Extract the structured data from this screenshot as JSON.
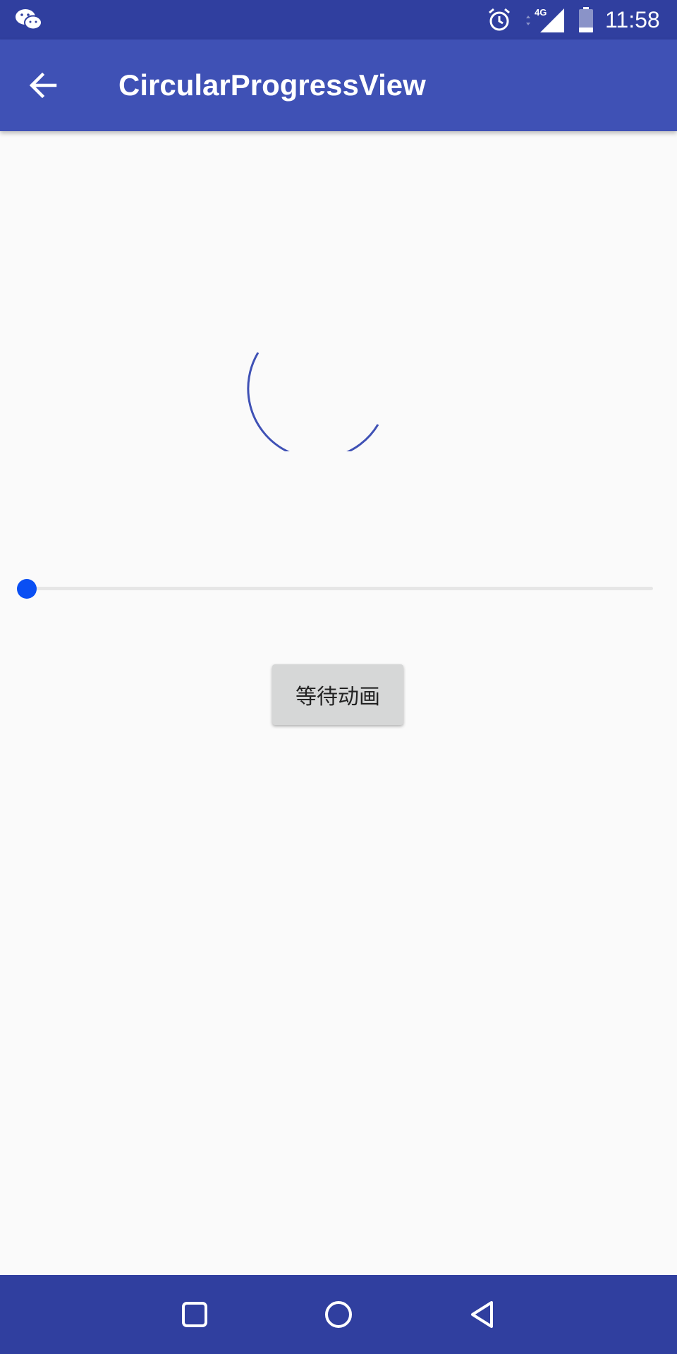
{
  "status_bar": {
    "time": "11:58",
    "network_label": "4G",
    "icons": [
      "wechat-icon",
      "alarm-icon",
      "signal-icon",
      "battery-icon"
    ]
  },
  "app_bar": {
    "title": "CircularProgressView",
    "back_icon": "back-arrow-icon"
  },
  "main": {
    "progress_view": {
      "state": "indeterminate",
      "color": "#3f51b5"
    },
    "seekbar": {
      "value": 0,
      "thumb_color": "#0a4ff3"
    },
    "wait_button_label": "等待动画"
  },
  "nav_bar": {
    "buttons": [
      "recents-icon",
      "home-icon",
      "back-triangle-icon"
    ]
  },
  "colors": {
    "primary_dark": "#303f9f",
    "primary": "#3f51b5",
    "accent": "#0a4ff3",
    "background": "#fafafa"
  }
}
